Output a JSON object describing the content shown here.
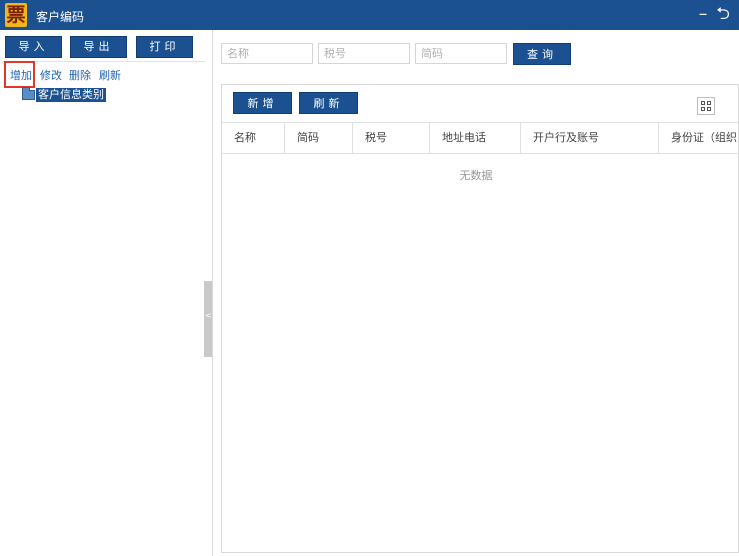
{
  "window": {
    "title": "客户编码",
    "logo_glyph": "票",
    "minimize_glyph": "–",
    "back_glyph": "⮌"
  },
  "left_toolbar": {
    "import_label": "导入",
    "export_label": "导出",
    "print_label": "打印"
  },
  "tree_actions": {
    "add": "增加",
    "edit": "修改",
    "delete": "删除",
    "refresh": "刷新"
  },
  "tree": {
    "root_label": "客户信息类别"
  },
  "splitter": {
    "arrow_glyph": "<"
  },
  "search": {
    "name_placeholder": "名称",
    "tax_placeholder": "税号",
    "code_placeholder": "简码",
    "query_label": "查询"
  },
  "grid": {
    "new_label": "新增",
    "refresh_label": "刷新",
    "columns": [
      "名称",
      "简码",
      "税号",
      "地址电话",
      "开户行及账号",
      "身份证（组织"
    ],
    "empty_text": "无数据"
  },
  "colors": {
    "accent": "#1b5191",
    "highlight": "#e0382c",
    "link": "#1f63b6"
  }
}
